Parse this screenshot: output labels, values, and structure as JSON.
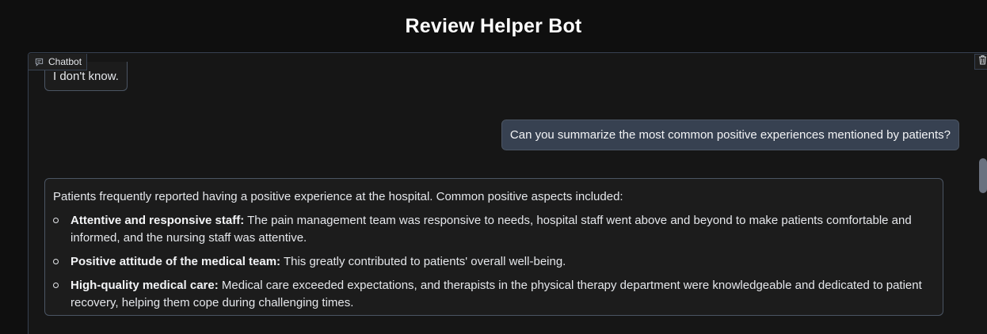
{
  "header": {
    "title": "Review Helper Bot"
  },
  "chat_panel": {
    "label": "Chatbot",
    "label_icon": "chat-bubble-icon",
    "clear_icon": "trash-icon"
  },
  "messages": [
    {
      "role": "bot",
      "text": "I don't know."
    },
    {
      "role": "user",
      "text": "Can you summarize the most common positive experiences mentioned by patients?"
    },
    {
      "role": "bot",
      "intro": "Patients frequently reported having a positive experience at the hospital. Common positive aspects included:",
      "items": [
        {
          "title": "Attentive and responsive staff:",
          "text": " The pain management team was responsive to needs, hospital staff went above and beyond to make patients comfortable and informed, and the nursing staff was attentive."
        },
        {
          "title": "Positive attitude of the medical team:",
          "text": " This greatly contributed to patients' overall well-being."
        },
        {
          "title": "High-quality medical care:",
          "text": " Medical care exceeded expectations, and therapists in the physical therapy department were knowledgeable and dedicated to patient recovery, helping them cope during challenging times."
        }
      ]
    }
  ],
  "colors": {
    "background": "#0f0f0f",
    "panel": "#161616",
    "user_bubble": "#374151",
    "border": "#4b5563"
  }
}
